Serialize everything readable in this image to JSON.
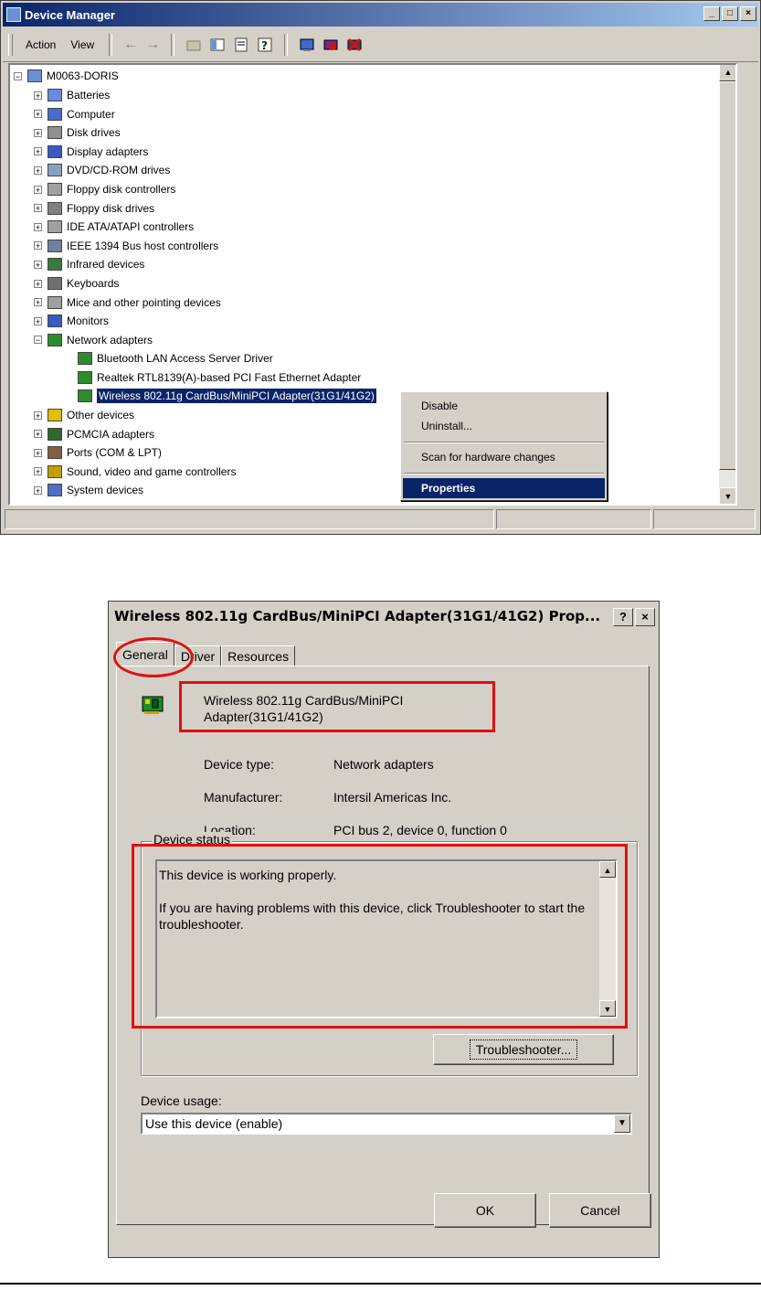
{
  "device_manager": {
    "title": "Device Manager",
    "window_buttons": [
      "_",
      "□",
      "×"
    ],
    "menu": [
      "Action",
      "View"
    ],
    "tree": {
      "root": "M0063-DORIS",
      "categories": [
        {
          "label": "Batteries",
          "icon": "battery-icon",
          "expanded": false
        },
        {
          "label": "Computer",
          "icon": "computer-icon",
          "expanded": false
        },
        {
          "label": "Disk drives",
          "icon": "disk-drive-icon",
          "expanded": false
        },
        {
          "label": "Display adapters",
          "icon": "display-adapter-icon",
          "expanded": false
        },
        {
          "label": "DVD/CD-ROM drives",
          "icon": "cd-rom-icon",
          "expanded": false
        },
        {
          "label": "Floppy disk controllers",
          "icon": "controller-icon",
          "expanded": false
        },
        {
          "label": "Floppy disk drives",
          "icon": "floppy-drive-icon",
          "expanded": false
        },
        {
          "label": "IDE ATA/ATAPI controllers",
          "icon": "controller-icon",
          "expanded": false
        },
        {
          "label": "IEEE 1394 Bus host controllers",
          "icon": "ieee1394-icon",
          "expanded": false
        },
        {
          "label": "Infrared devices",
          "icon": "infrared-icon",
          "expanded": false
        },
        {
          "label": "Keyboards",
          "icon": "keyboard-icon",
          "expanded": false
        },
        {
          "label": "Mice and other pointing devices",
          "icon": "mouse-icon",
          "expanded": false
        },
        {
          "label": "Monitors",
          "icon": "monitor-icon",
          "expanded": false
        },
        {
          "label": "Network adapters",
          "icon": "network-adapter-icon",
          "expanded": true
        },
        {
          "label": "Other devices",
          "icon": "question-icon",
          "expanded": false
        },
        {
          "label": "PCMCIA adapters",
          "icon": "pcmcia-icon",
          "expanded": false
        },
        {
          "label": "Ports (COM & LPT)",
          "icon": "port-icon",
          "expanded": false
        },
        {
          "label": "Sound, video and game controllers",
          "icon": "sound-icon",
          "expanded": false
        },
        {
          "label": "System devices",
          "icon": "system-icon",
          "expanded": false
        }
      ],
      "network_children": [
        "Bluetooth LAN Access Server Driver",
        "Realtek RTL8139(A)-based PCI Fast Ethernet Adapter",
        "Wireless 802.11g CardBus/MiniPCI Adapter(31G1/41G2)"
      ]
    },
    "context_menu": [
      "Disable",
      "Uninstall...",
      "Scan for hardware changes",
      "Properties"
    ]
  },
  "properties_dialog": {
    "title": "Wireless 802.11g CardBus/MiniPCI Adapter(31G1/41G2) Prop...",
    "title_buttons": [
      "?",
      "×"
    ],
    "tabs": [
      "General",
      "Driver",
      "Resources"
    ],
    "device_name_line1": "Wireless 802.11g CardBus/MiniPCI",
    "device_name_line2": "Adapter(31G1/41G2)",
    "props": [
      {
        "label": "Device type:",
        "value": "Network adapters"
      },
      {
        "label": "Manufacturer:",
        "value": "Intersil Americas Inc."
      },
      {
        "label": "Location:",
        "value": "PCI bus 2, device 0, function 0"
      }
    ],
    "device_status_label": "Device status",
    "status_line1": "This device is working properly.",
    "status_line2": "If you are having problems with this device, click Troubleshooter to start the troubleshooter.",
    "troubleshooter_button": "Troubleshooter...",
    "device_usage_label": "Device usage:",
    "device_usage_value": "Use this device (enable)",
    "ok_button": "OK",
    "cancel_button": "Cancel"
  },
  "colors": {
    "titlebar_blue": "#0a246a",
    "window_face": "#d4d0c8",
    "highlight_red": "#e01010"
  }
}
